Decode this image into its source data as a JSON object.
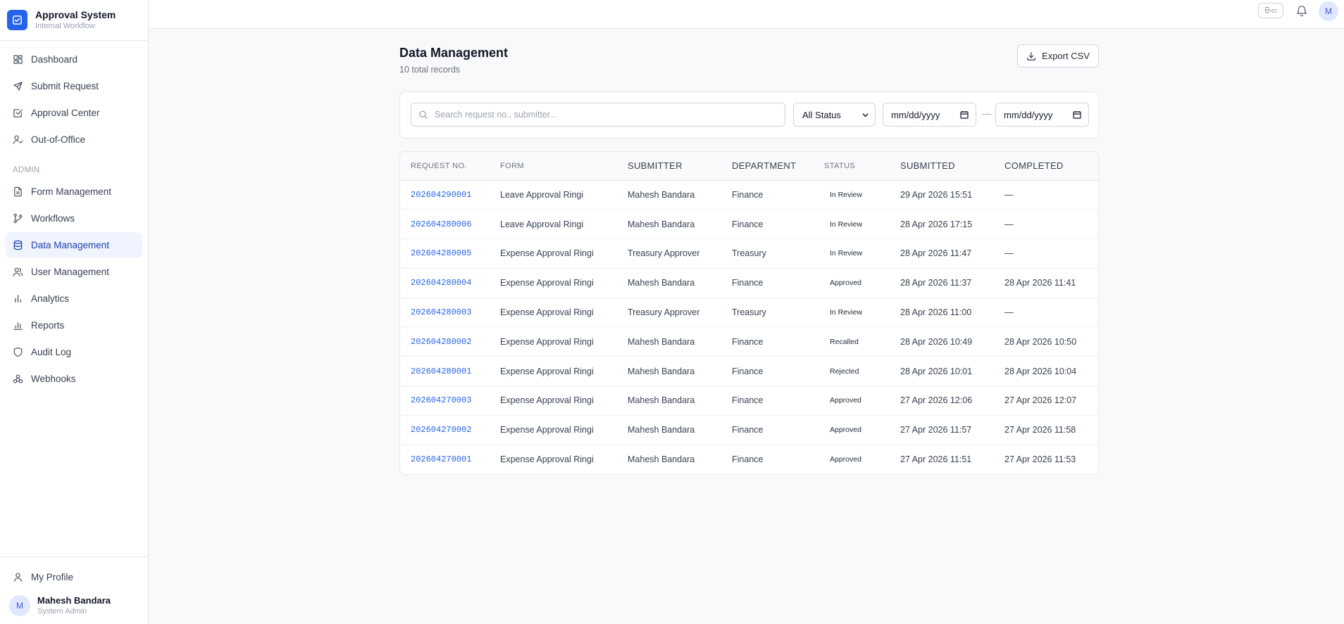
{
  "app": {
    "title": "Approval System",
    "subtitle": "Internal Workflow"
  },
  "sidebar": {
    "items": [
      {
        "label": "Dashboard",
        "icon": "dashboard-icon"
      },
      {
        "label": "Submit Request",
        "icon": "send-icon"
      },
      {
        "label": "Approval Center",
        "icon": "check-square-icon"
      },
      {
        "label": "Out-of-Office",
        "icon": "user-clock-icon"
      }
    ],
    "admin_label": "ADMIN",
    "admin_items": [
      {
        "label": "Form Management",
        "icon": "file-icon"
      },
      {
        "label": "Workflows",
        "icon": "branch-icon"
      },
      {
        "label": "Data Management",
        "icon": "database-icon"
      },
      {
        "label": "User Management",
        "icon": "users-icon"
      },
      {
        "label": "Analytics",
        "icon": "bar-chart-icon"
      },
      {
        "label": "Reports",
        "icon": "report-icon"
      },
      {
        "label": "Audit Log",
        "icon": "shield-icon"
      },
      {
        "label": "Webhooks",
        "icon": "webhook-icon"
      }
    ],
    "active_item": "Data Management",
    "profile_label": "My Profile",
    "user": {
      "initial": "M",
      "name": "Mahesh Bandara",
      "role": "System Admin"
    }
  },
  "topbar": {
    "lang_label": "සිංහ",
    "avatar_initial": "M"
  },
  "page": {
    "title": "Data Management",
    "subtitle": "10 total records",
    "export_label": "Export CSV"
  },
  "filters": {
    "search_placeholder": "Search request no., submitter...",
    "status_value": "All Status",
    "date_from": "mm/dd/yyyy",
    "date_to": "mm/dd/yyyy",
    "date_separator": "—"
  },
  "table": {
    "columns": [
      "REQUEST NO.",
      "FORM",
      "SUBMITTER",
      "DEPARTMENT",
      "STATUS",
      "SUBMITTED",
      "COMPLETED"
    ],
    "rows": [
      {
        "req": "202604290001",
        "form": "Leave Approval Ringi",
        "submitter": "Mahesh Bandara",
        "dept": "Finance",
        "status": "In Review",
        "submitted": "29 Apr 2026 15:51",
        "completed": "—"
      },
      {
        "req": "202604280006",
        "form": "Leave Approval Ringi",
        "submitter": "Mahesh Bandara",
        "dept": "Finance",
        "status": "In Review",
        "submitted": "28 Apr 2026 17:15",
        "completed": "—"
      },
      {
        "req": "202604280005",
        "form": "Expense Approval Ringi",
        "submitter": "Treasury Approver",
        "dept": "Treasury",
        "status": "In Review",
        "submitted": "28 Apr 2026 11:47",
        "completed": "—"
      },
      {
        "req": "202604280004",
        "form": "Expense Approval Ringi",
        "submitter": "Mahesh Bandara",
        "dept": "Finance",
        "status": "Approved",
        "submitted": "28 Apr 2026 11:37",
        "completed": "28 Apr 2026 11:41"
      },
      {
        "req": "202604280003",
        "form": "Expense Approval Ringi",
        "submitter": "Treasury Approver",
        "dept": "Treasury",
        "status": "In Review",
        "submitted": "28 Apr 2026 11:00",
        "completed": "—"
      },
      {
        "req": "202604280002",
        "form": "Expense Approval Ringi",
        "submitter": "Mahesh Bandara",
        "dept": "Finance",
        "status": "Recalled",
        "submitted": "28 Apr 2026 10:49",
        "completed": "28 Apr 2026 10:50"
      },
      {
        "req": "202604280001",
        "form": "Expense Approval Ringi",
        "submitter": "Mahesh Bandara",
        "dept": "Finance",
        "status": "Rejected",
        "submitted": "28 Apr 2026 10:01",
        "completed": "28 Apr 2026 10:04"
      },
      {
        "req": "202604270003",
        "form": "Expense Approval Ringi",
        "submitter": "Mahesh Bandara",
        "dept": "Finance",
        "status": "Approved",
        "submitted": "27 Apr 2026 12:06",
        "completed": "27 Apr 2026 12:07"
      },
      {
        "req": "202604270002",
        "form": "Expense Approval Ringi",
        "submitter": "Mahesh Bandara",
        "dept": "Finance",
        "status": "Approved",
        "submitted": "27 Apr 2026 11:57",
        "completed": "27 Apr 2026 11:58"
      },
      {
        "req": "202604270001",
        "form": "Expense Approval Ringi",
        "submitter": "Mahesh Bandara",
        "dept": "Finance",
        "status": "Approved",
        "submitted": "27 Apr 2026 11:51",
        "completed": "27 Apr 2026 11:53"
      }
    ]
  },
  "colors": {
    "brand": "#2563eb",
    "active_bg": "#eff4ff",
    "link": "#2563eb"
  }
}
